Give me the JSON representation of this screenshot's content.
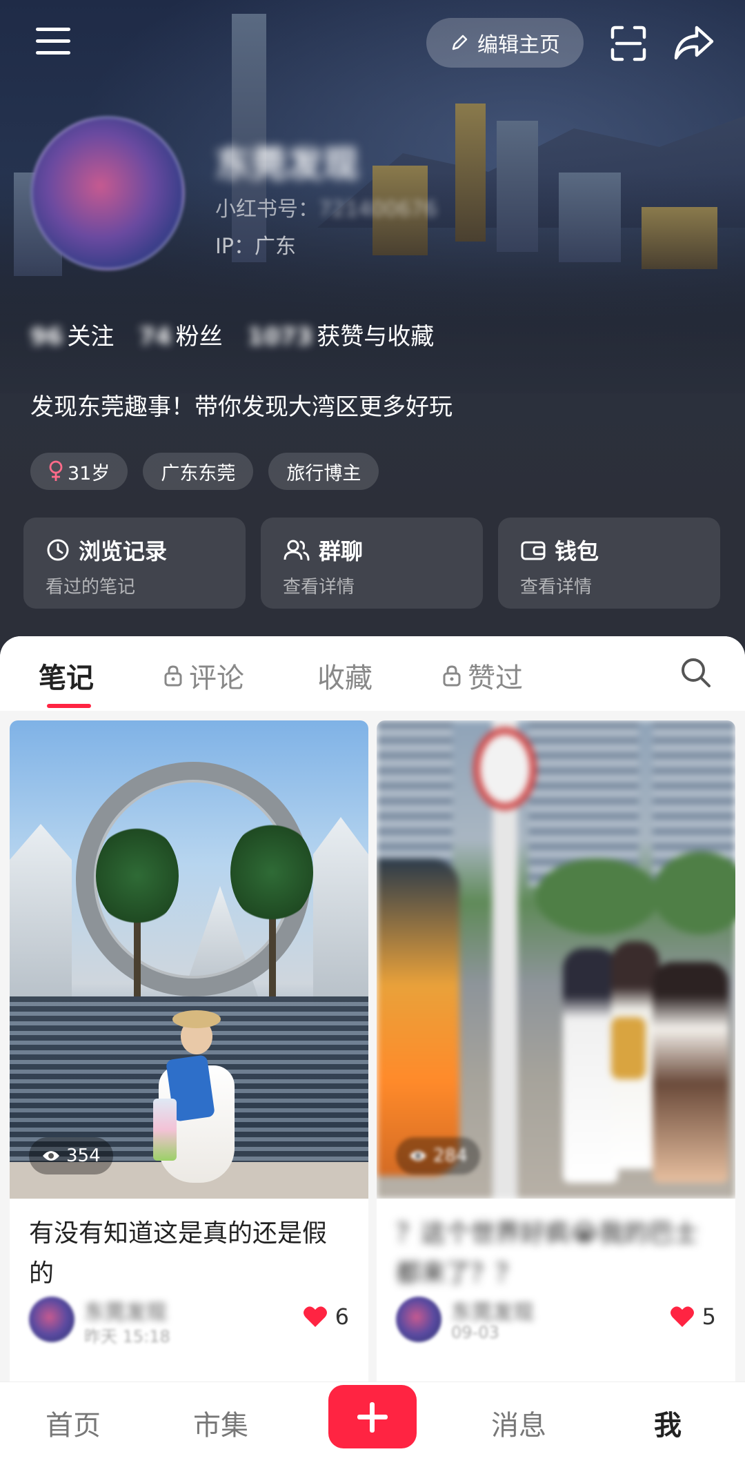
{
  "header": {
    "edit_label": "编辑主页",
    "username": "东莞发现",
    "rid_label": "小红书号：",
    "rid_value": "721400676",
    "ip_label": "IP：广东"
  },
  "stats": [
    {
      "num": "96",
      "label": "关注"
    },
    {
      "num": "74",
      "label": "粉丝"
    },
    {
      "num": "1073",
      "label": "获赞与收藏"
    }
  ],
  "bio": "发现东莞趣事！带你发现大湾区更多好玩",
  "tags": [
    {
      "label": "31岁",
      "icon": "female-icon"
    },
    {
      "label": "广东东莞"
    },
    {
      "label": "旅行博主"
    }
  ],
  "quick_cards": [
    {
      "title": "浏览记录",
      "sub": "看过的笔记",
      "icon": "history-icon"
    },
    {
      "title": "群聊",
      "sub": "查看详情",
      "icon": "group-icon"
    },
    {
      "title": "钱包",
      "sub": "查看详情",
      "icon": "wallet-icon"
    }
  ],
  "tabs": [
    {
      "label": "笔记",
      "active": true
    },
    {
      "label": "评论",
      "locked": true
    },
    {
      "label": "收藏"
    },
    {
      "label": "赞过",
      "locked": true
    }
  ],
  "notes": [
    {
      "views": "354",
      "title": "有没有知道这是真的还是假的",
      "author": "东莞发现",
      "date": "昨天 15:18",
      "likes": "6"
    },
    {
      "views": "284",
      "title": "？这个世界好疯😭我的巴士都来了？？",
      "author": "东莞发现",
      "date": "09-03",
      "likes": "5"
    }
  ],
  "bottom_nav": [
    {
      "label": "首页"
    },
    {
      "label": "市集"
    },
    {
      "label": "消息"
    },
    {
      "label": "我",
      "active": true
    }
  ],
  "colors": {
    "accent": "#ff2442",
    "hero_bg": "#2c2f39"
  }
}
